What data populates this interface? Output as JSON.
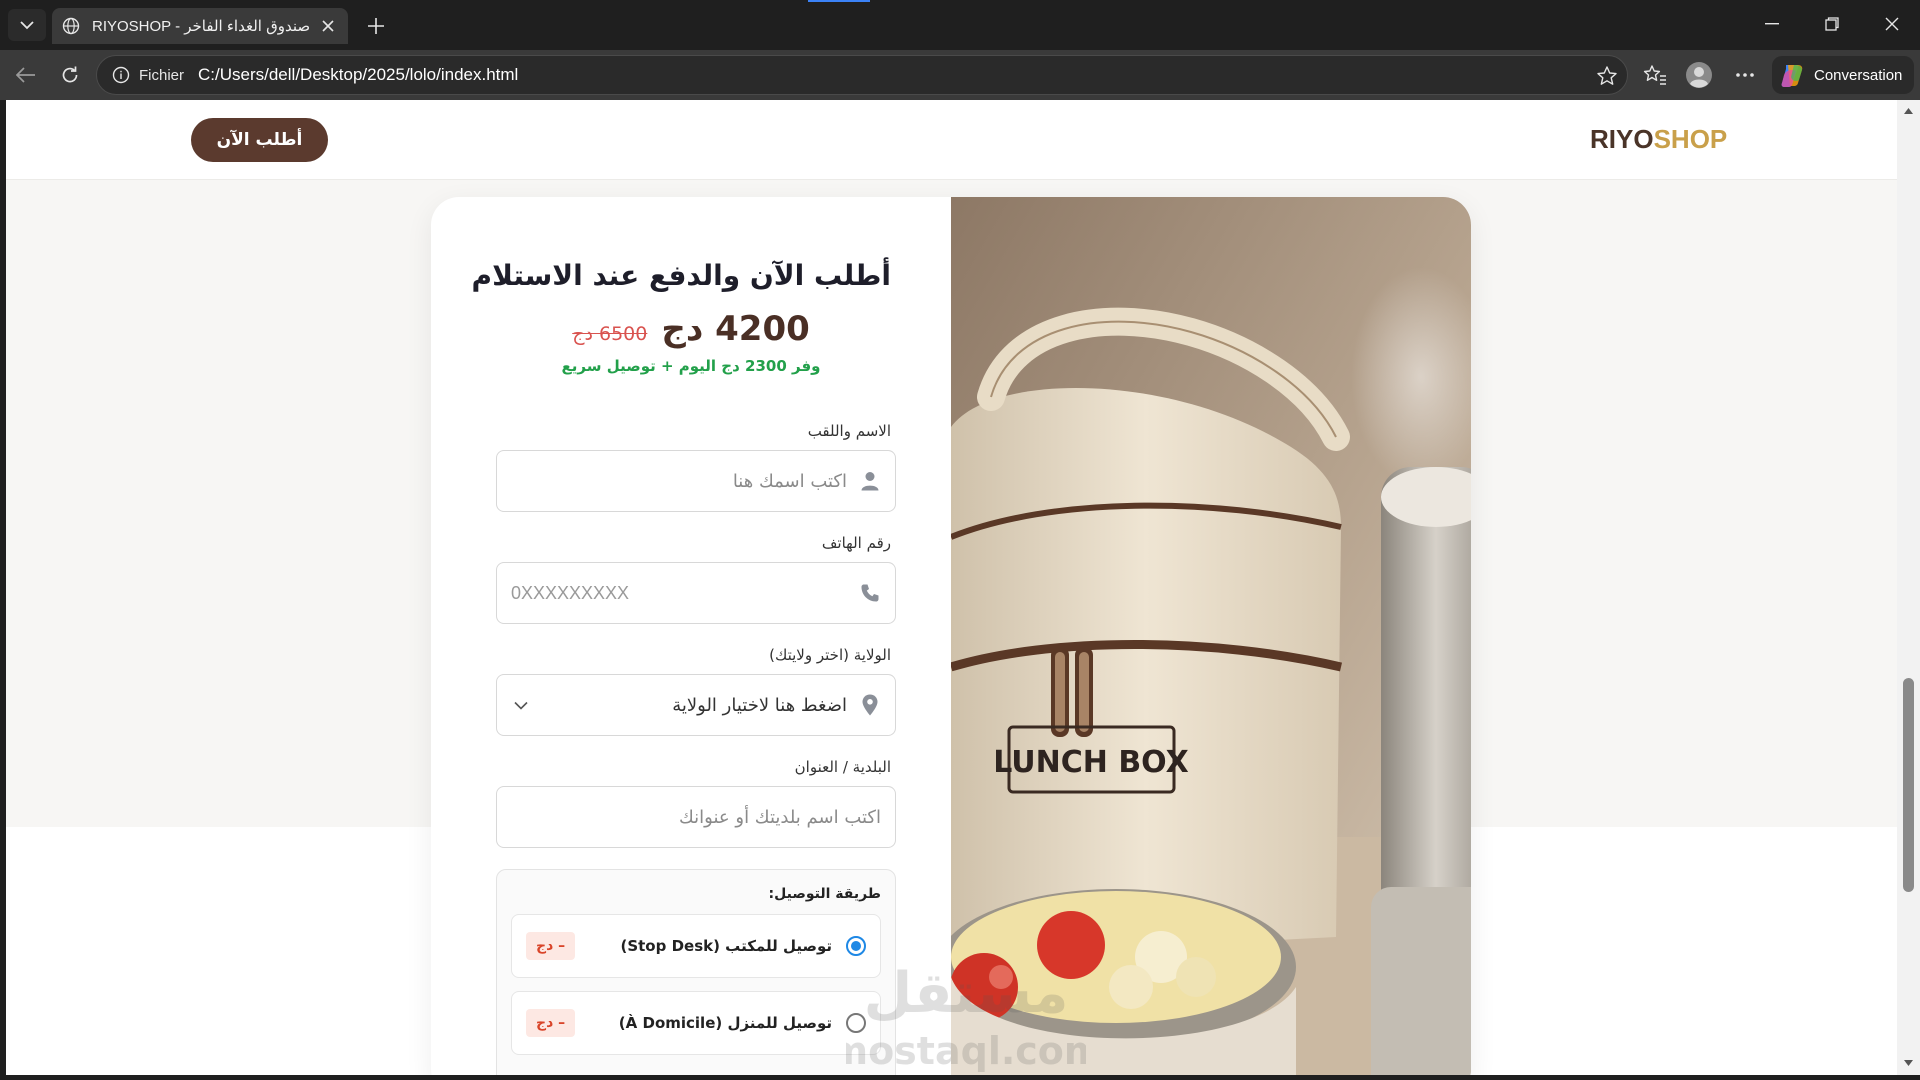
{
  "browser": {
    "tab_title": "RIYOSHOP - صندوق الغداء الفاخر",
    "scheme_label": "Fichier",
    "url": "C:/Users/dell/Desktop/2025/lolo/index.html",
    "conversation_label": "Conversation"
  },
  "header": {
    "logo_part1": "RIYO",
    "logo_part2": "SHOP",
    "cta_label": "أطلب الآن"
  },
  "form": {
    "title": "أطلب الآن والدفع عند الاستلام",
    "price_new": "4200 دج",
    "price_old": "6500 دج",
    "savings": "وفر 2300 دج اليوم + توصيل سريع",
    "name_label": "الاسم واللقب",
    "name_placeholder": "اكتب اسمك هنا",
    "phone_label": "رقم الهاتف",
    "phone_placeholder": "0XXXXXXXXX",
    "wilaya_label": "الولاية (اختر ولايتك)",
    "wilaya_selected": "اضغط هنا لاختيار الولاية",
    "address_label": "البلدية / العنوان",
    "address_placeholder": "اكتب اسم بلديتك أو عنوانك",
    "delivery_title": "طريقة التوصيل:",
    "options": [
      {
        "label": "توصيل للمكتب (Stop Desk)",
        "price": "– دج",
        "checked": true
      },
      {
        "label": "توصيل للمنزل (À Domicile)",
        "price": "– دج",
        "checked": false
      }
    ]
  },
  "image": {
    "box_text": "LUNCH BOX"
  },
  "watermark": {
    "arabic": "مستقل",
    "latin": "mostaql.com"
  },
  "colors": {
    "brand_brown": "#5b3a2e",
    "brand_gold": "#c9a04a",
    "savings_green": "#22a04a",
    "old_price_red": "#d9534f",
    "radio_blue": "#1e88e5"
  },
  "icons": [
    "globe-icon",
    "close-icon",
    "plus-icon",
    "back-icon",
    "reload-icon",
    "info-icon",
    "star-icon",
    "favorites-icon",
    "profile-icon",
    "more-icon",
    "copilot-icon",
    "user-icon",
    "phone-icon",
    "location-pin-icon",
    "chevron-down-icon"
  ]
}
